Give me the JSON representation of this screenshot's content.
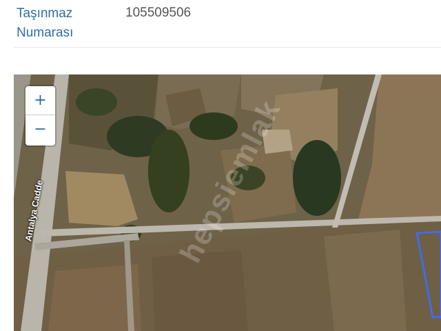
{
  "info": {
    "label": "Taşınmaz Numarası",
    "value": "105509506"
  },
  "map": {
    "zoom_in_label": "+",
    "zoom_out_label": "−",
    "street_label": "Antalya Cadde",
    "watermark": "hepsiemlak",
    "parcel_color": "#3d6ee8",
    "road_color": "#bdb8ae"
  }
}
